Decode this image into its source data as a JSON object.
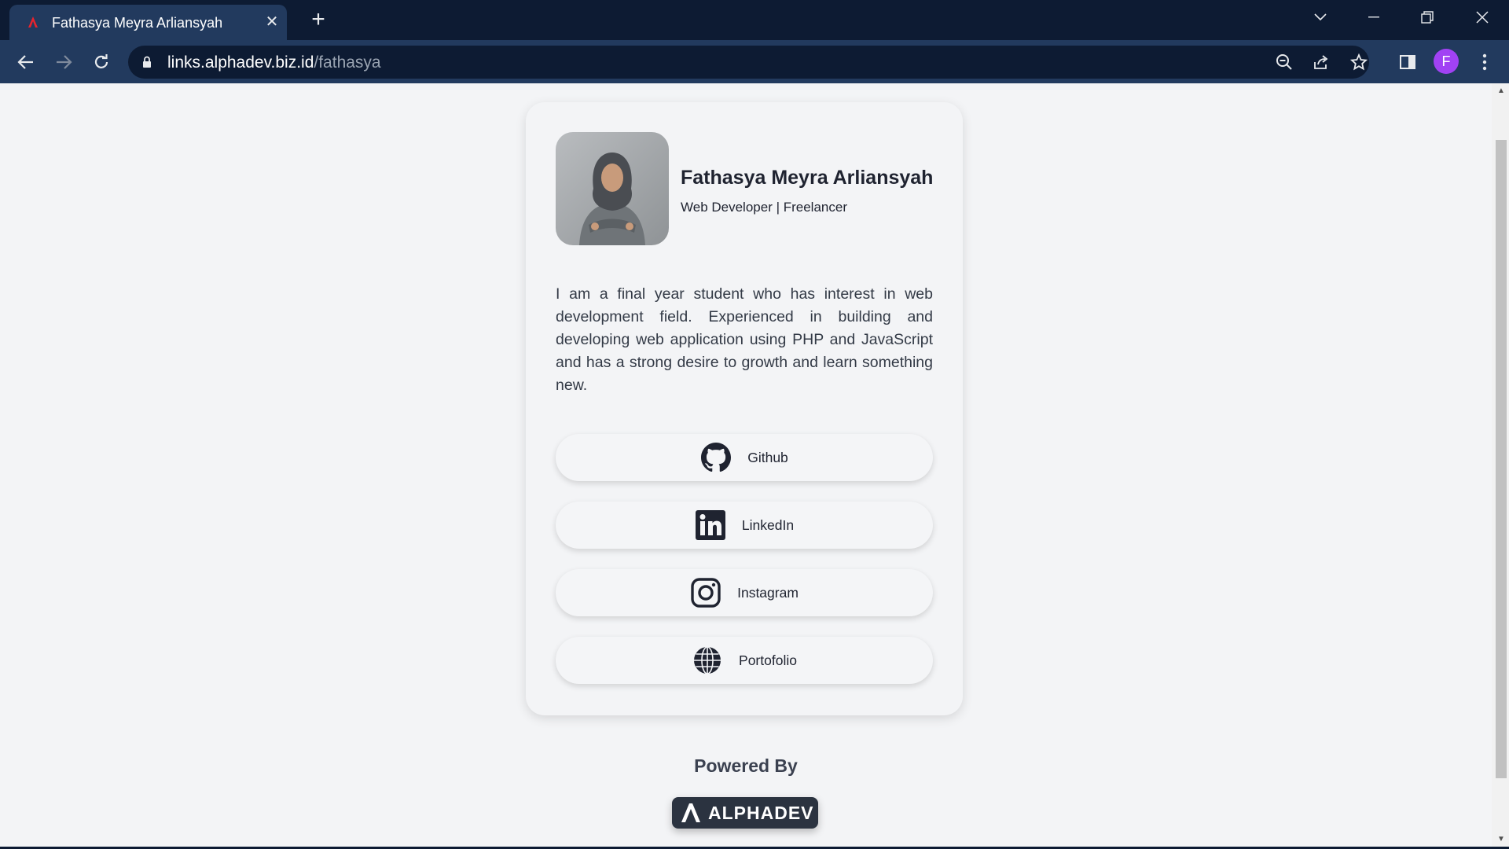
{
  "browser": {
    "tab_title": "Fathasya Meyra Arliansyah",
    "tab_close": "✕",
    "new_tab": "+",
    "url_host": "links.alphadev.biz.id",
    "url_path": "/fathasya",
    "profile_initial": "F",
    "colors": {
      "frame": "#0d1b33",
      "toolbar": "#223a5e",
      "avatar": "#a142f4"
    }
  },
  "profile": {
    "name": "Fathasya Meyra Arliansyah",
    "role": "Web Developer | Freelancer",
    "bio": "I am a final year student who has interest in web development field. Experienced in building and developing web application using PHP and JavaScript and has a strong desire to growth and learn something new."
  },
  "links": [
    {
      "label": "Github",
      "icon": "github-icon"
    },
    {
      "label": "LinkedIn",
      "icon": "linkedin-icon"
    },
    {
      "label": "Instagram",
      "icon": "instagram-icon"
    },
    {
      "label": "Portofolio",
      "icon": "globe-icon"
    }
  ],
  "footer": {
    "powered_by": "Powered By",
    "brand": "ALPHADEV"
  }
}
